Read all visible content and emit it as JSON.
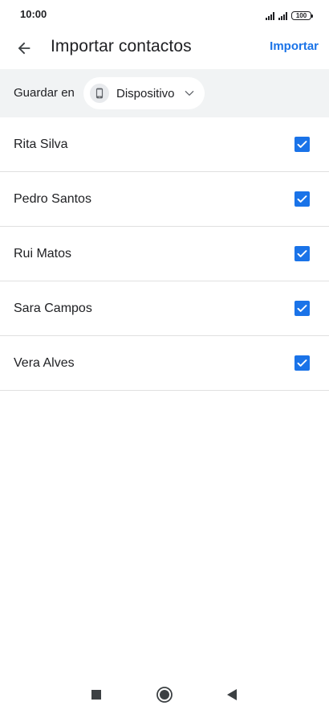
{
  "status_bar": {
    "time": "10:00",
    "battery_level": "100"
  },
  "app_bar": {
    "title": "Importar contactos",
    "action_label": "Importar",
    "back_icon": "arrow-back-icon"
  },
  "save_to": {
    "label": "Guardar en",
    "selected_account": "Dispositivo",
    "account_icon": "phone-icon",
    "dropdown_icon": "chevron-down-icon"
  },
  "contacts": [
    {
      "name": "Rita Silva",
      "checked": true
    },
    {
      "name": "Pedro Santos",
      "checked": true
    },
    {
      "name": "Rui Matos",
      "checked": true
    },
    {
      "name": "Sara Campos",
      "checked": true
    },
    {
      "name": "Vera Alves",
      "checked": true
    }
  ],
  "nav_bar": {
    "recents_icon": "square-icon",
    "home_icon": "circle-icon",
    "back_icon": "triangle-back-icon"
  },
  "colors": {
    "accent": "#1a73e8",
    "subheader_bg": "#f1f3f4",
    "divider": "#e0e0e0"
  }
}
